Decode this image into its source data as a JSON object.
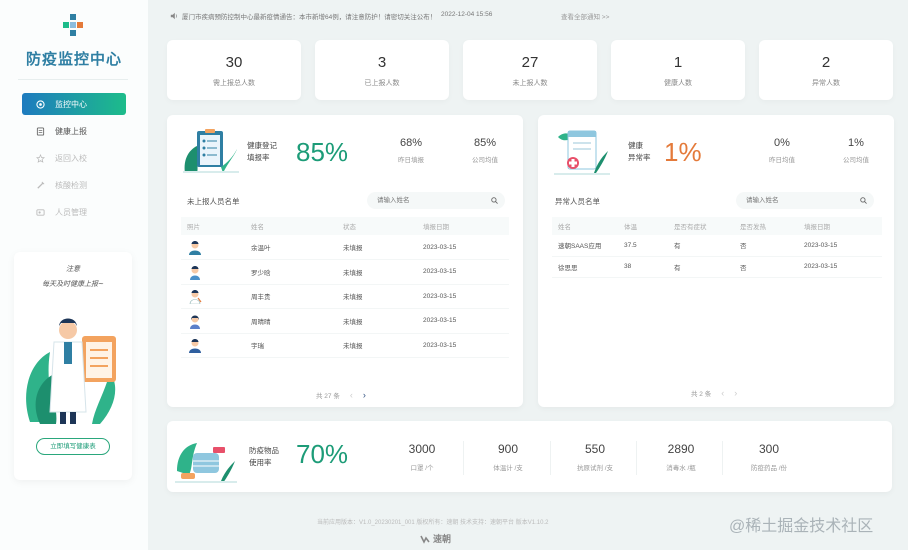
{
  "brand": {
    "title": "防疫监控中心"
  },
  "nav": [
    {
      "label": "监控中心",
      "active": true
    },
    {
      "label": "健康上报",
      "active": false
    },
    {
      "label": "返回入校",
      "active": false
    },
    {
      "label": "核酸检测",
      "active": false
    },
    {
      "label": "人员管理",
      "active": false
    }
  ],
  "promo": {
    "line1": "注意",
    "line2": "每天及时健康上报~",
    "button": "立即填写健康表"
  },
  "notice": {
    "text": "厦门市疾病预防控制中心最新疫情通告：本市新增64例，请注意防护！请密切关注公布！",
    "time": "2022-12-04 15:56",
    "more": "查看全部通知 >>"
  },
  "stats": [
    {
      "value": "30",
      "label": "需上报总人数"
    },
    {
      "value": "3",
      "label": "已上报人数"
    },
    {
      "value": "27",
      "label": "未上报人数"
    },
    {
      "value": "1",
      "label": "健康人数"
    },
    {
      "value": "2",
      "label": "异常人数"
    }
  ],
  "health": {
    "label1": "健康登记",
    "label2": "填报率",
    "rate": "85%",
    "mini": [
      {
        "value": "68%",
        "label": "昨日填报"
      },
      {
        "value": "85%",
        "label": "公司均值"
      }
    ],
    "list_title": "未上报人员名单",
    "search_placeholder": "请输入姓名",
    "columns": [
      "照片",
      "姓名",
      "状态",
      "填报日期"
    ],
    "rows": [
      {
        "name": "余温叶",
        "status": "未填报",
        "date": "2023-03-15"
      },
      {
        "name": "罗少晗",
        "status": "未填报",
        "date": "2023-03-15"
      },
      {
        "name": "周丰贵",
        "status": "未填报",
        "date": "2023-03-15"
      },
      {
        "name": "周晴晴",
        "status": "未填报",
        "date": "2023-03-15"
      },
      {
        "name": "宇瑞",
        "status": "未填报",
        "date": "2023-03-15"
      }
    ],
    "pager": "共 27 条"
  },
  "abnormal": {
    "label1": "健康",
    "label2": "异常率",
    "rate": "1%",
    "mini": [
      {
        "value": "0%",
        "label": "昨日均值"
      },
      {
        "value": "1%",
        "label": "公司均值"
      }
    ],
    "list_title": "异常人员名单",
    "search_placeholder": "请输入姓名",
    "columns": [
      "姓名",
      "体温",
      "是否有症状",
      "是否发热",
      "填报日期"
    ],
    "rows": [
      {
        "name": "速朝SAAS应用",
        "temp": "37.5",
        "symptom": "有",
        "fever": "否",
        "date": "2023-03-15"
      },
      {
        "name": "徐思思",
        "temp": "38",
        "symptom": "有",
        "fever": "否",
        "date": "2023-03-15"
      }
    ],
    "pager": "共 2 条"
  },
  "supplies": {
    "label1": "防疫物品",
    "label2": "使用率",
    "rate": "70%",
    "items": [
      {
        "value": "3000",
        "label": "口罩 /个"
      },
      {
        "value": "900",
        "label": "体温计 /支"
      },
      {
        "value": "550",
        "label": "抗原试剂 /支"
      },
      {
        "value": "2890",
        "label": "消毒水 /瓶"
      },
      {
        "value": "300",
        "label": "防疫药品 /份"
      }
    ]
  },
  "footer": {
    "text": "当前应用版本：V1.0_20230201_001 版权所有：速朝 技术支持：速朝平台 版本V1.10.2",
    "logo": "速朝"
  },
  "watermark": "@稀土掘金技术社区",
  "colors": {
    "accent": "#1d9c78",
    "brand": "#2f7fa3",
    "orange": "#e47a3a",
    "nav_gradient_start": "#1e7bbf",
    "nav_gradient_end": "#1dbc8a"
  },
  "icons": {
    "speaker": "speaker-icon",
    "search": "search-icon"
  }
}
